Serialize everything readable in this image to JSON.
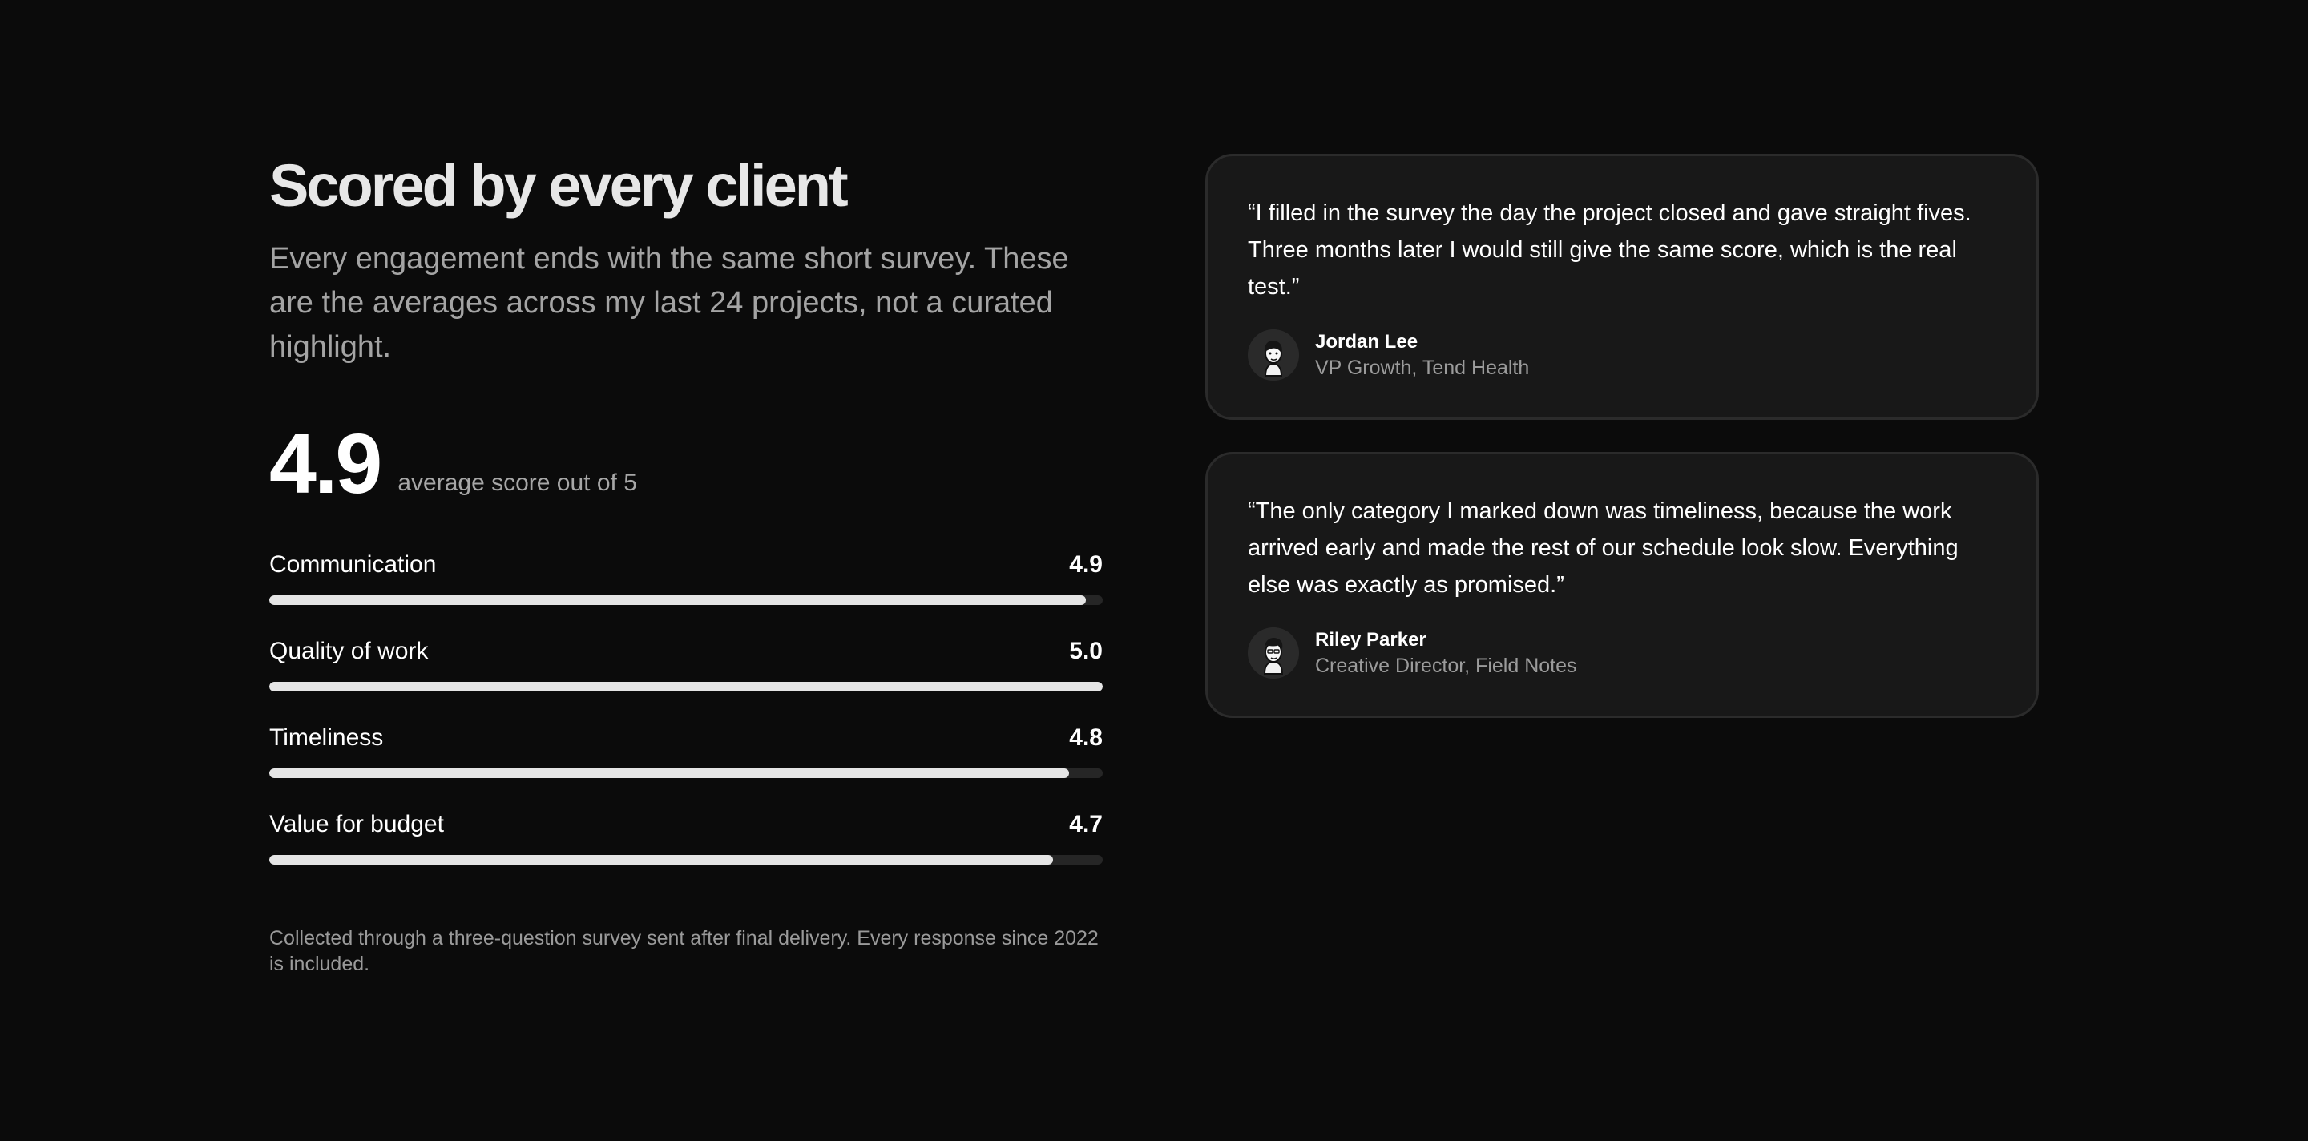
{
  "header": {
    "title": "Scored by every client",
    "intro": "Every engagement ends with the same short survey. These are the averages across my last 24 projects, not a curated highlight."
  },
  "summary": {
    "score": "4.9",
    "caption": "average score out of 5"
  },
  "ratings": [
    {
      "label": "Communication",
      "value": "4.9",
      "fill": 0.98
    },
    {
      "label": "Quality of work",
      "value": "5.0",
      "fill": 1.0
    },
    {
      "label": "Timeliness",
      "value": "4.8",
      "fill": 0.96
    },
    {
      "label": "Value for budget",
      "value": "4.7",
      "fill": 0.94
    }
  ],
  "footnote": "Collected through a three-question survey sent after final delivery. Every response since 2022 is included.",
  "testimonials": [
    {
      "quote": "“I filled in the survey the day the project closed and gave straight fives. Three months later I would still give the same score, which is the real test.”",
      "name": "Jordan Lee",
      "role": "VP Growth, Tend Health",
      "avatar_icon": "avatar-illustration-icon"
    },
    {
      "quote": "“The only category I marked down was timeliness, because the work arrived early and made the rest of our schedule look slow. Everything else was exactly as promised.”",
      "name": "Riley Parker",
      "role": "Creative Director, Field Notes",
      "avatar_icon": "avatar-illustration-icon"
    }
  ],
  "colors": {
    "background": "#0b0b0b",
    "card_background": "#181818",
    "bar_fill": "#e5e5e5",
    "bar_track": "#262626"
  }
}
